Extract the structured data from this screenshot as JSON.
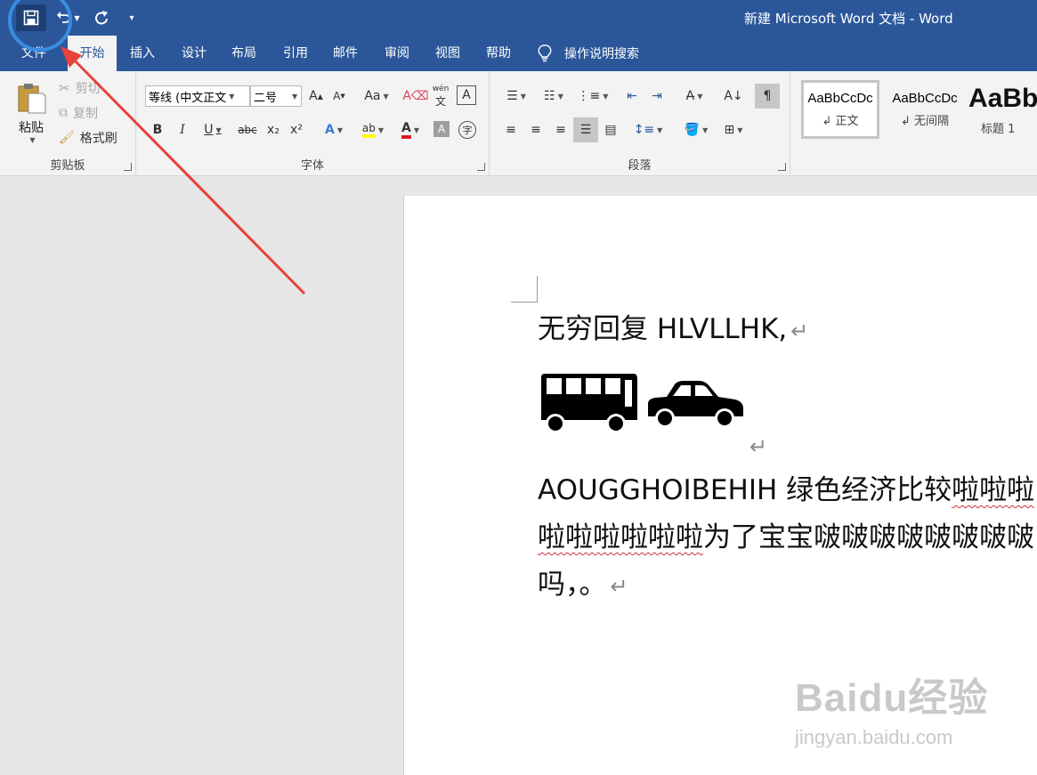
{
  "window": {
    "title": "新建 Microsoft Word 文档 - Word"
  },
  "quick_access": {
    "save_icon": "save-icon",
    "undo_icon": "undo-icon",
    "redo_icon": "redo-icon",
    "customize_glyph": "▾"
  },
  "tabs": [
    {
      "label": "文件"
    },
    {
      "label": "开始"
    },
    {
      "label": "插入"
    },
    {
      "label": "设计"
    },
    {
      "label": "布局"
    },
    {
      "label": "引用"
    },
    {
      "label": "邮件"
    },
    {
      "label": "审阅"
    },
    {
      "label": "视图"
    },
    {
      "label": "帮助"
    }
  ],
  "tell_me": {
    "label": "操作说明搜索"
  },
  "clipboard": {
    "paste": "粘贴",
    "cut": "剪切",
    "copy": "复制",
    "format_painter": "格式刷",
    "group_label": "剪贴板"
  },
  "font": {
    "font_name": "等线 (中文正文",
    "font_size": "二号",
    "group_label": "字体",
    "grow": "A",
    "shrink": "A",
    "change_case": "Aa",
    "phonetic": "wén",
    "bold": "B",
    "italic": "I",
    "underline": "U",
    "strike": "abc",
    "subscript": "x₂",
    "superscript": "x²"
  },
  "paragraph": {
    "group_label": "段落"
  },
  "styles": {
    "items": [
      {
        "sample": "AaBbCcDc",
        "name": "↲ 正文"
      },
      {
        "sample": "AaBbCcDc",
        "name": "↲ 无间隔"
      },
      {
        "sample": "AaBb",
        "name": "标题 1"
      }
    ]
  },
  "document": {
    "para1": "无穷回复 HLVLLHK,",
    "para3_prefix": "AOUGGHOIBEHIH 绿色经济比较",
    "para3_squiggle": "啦啦啦啦啦啦啦啦啦",
    "para3_suffix": "为了宝宝啵啵啵啵啵啵啵啵吗，。",
    "mark": "↵"
  },
  "colors": {
    "brand": "#2b579a",
    "annotation": "#e8423a",
    "highlight_circle": "#3a8de0",
    "highlight_yellow": "#ffff00",
    "font_red": "#e81123"
  },
  "watermark": {
    "logo": "Baidu经验",
    "url": "jingyan.baidu.com"
  }
}
